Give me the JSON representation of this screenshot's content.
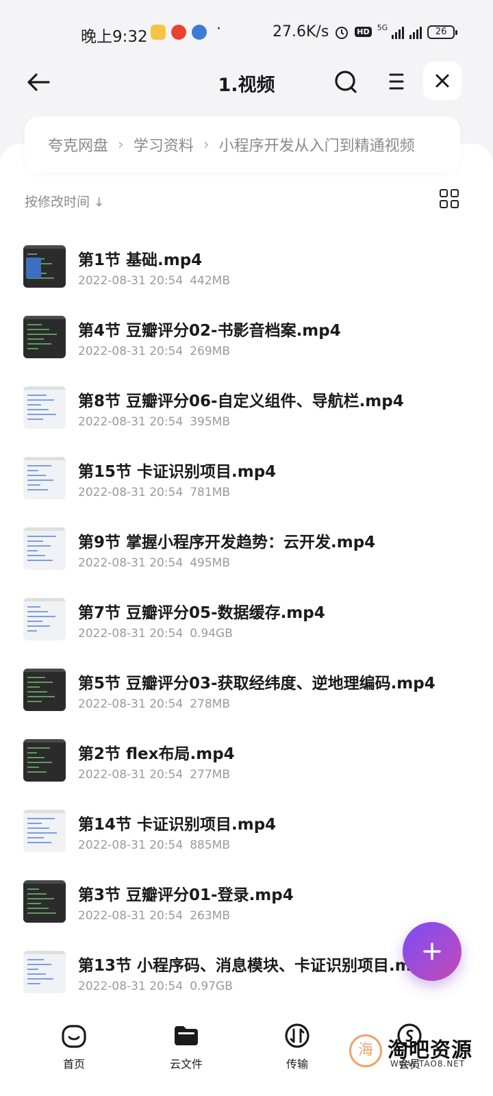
{
  "status_bar": {
    "time": "晚上9:32",
    "dot": "·",
    "speed": "27.6K/s",
    "hd": "HD",
    "network": "5G",
    "battery": "26"
  },
  "header": {
    "title": "1.视频",
    "back_icon": "arrow-left-icon",
    "search_icon": "search-icon",
    "menu_icon": "menu-icon",
    "close_icon": "close-icon"
  },
  "breadcrumb": [
    "夸克网盘",
    "学习资料",
    "小程序开发从入门到精通视频"
  ],
  "sort": {
    "label": "按修改时间",
    "arrow": "↓"
  },
  "files": [
    {
      "name": "第1节 基础.mp4",
      "date": "2022-08-31 20:54",
      "size": "442MB",
      "thumb": "dark-blue"
    },
    {
      "name": "第4节 豆瓣评分02-书影音档案.mp4",
      "date": "2022-08-31 20:54",
      "size": "269MB",
      "thumb": "dark"
    },
    {
      "name": "第8节 豆瓣评分06-自定义组件、导航栏.mp4",
      "date": "2022-08-31 20:54",
      "size": "395MB",
      "thumb": "light"
    },
    {
      "name": "第15节  卡证识别项目.mp4",
      "date": "2022-08-31 20:54",
      "size": "781MB",
      "thumb": "light"
    },
    {
      "name": "第9节 掌握小程序开发趋势：云开发.mp4",
      "date": "2022-08-31 20:54",
      "size": "495MB",
      "thumb": "light"
    },
    {
      "name": "第7节 豆瓣评分05-数据缓存.mp4",
      "date": "2022-08-31 20:54",
      "size": "0.94GB",
      "thumb": "light"
    },
    {
      "name": "第5节 豆瓣评分03-获取经纬度、逆地理编码.mp4",
      "date": "2022-08-31 20:54",
      "size": "278MB",
      "thumb": "dark"
    },
    {
      "name": "第2节 flex布局.mp4",
      "date": "2022-08-31 20:54",
      "size": "277MB",
      "thumb": "dark"
    },
    {
      "name": "第14节 卡证识别项目.mp4",
      "date": "2022-08-31 20:54",
      "size": "885MB",
      "thumb": "light"
    },
    {
      "name": "第3节 豆瓣评分01-登录.mp4",
      "date": "2022-08-31 20:54",
      "size": "263MB",
      "thumb": "dark"
    },
    {
      "name": "第13节 小程序码、消息模块、卡证识别项目.mp4",
      "date": "2022-08-31 20:54",
      "size": "0.97GB",
      "thumb": "light"
    }
  ],
  "fab": {
    "icon": "plus-icon",
    "label": "+"
  },
  "bottom_nav": [
    {
      "label": "首页",
      "icon": "home-icon"
    },
    {
      "label": "云文件",
      "icon": "folder-icon"
    },
    {
      "label": "传输",
      "icon": "transfer-icon"
    },
    {
      "label": "会员",
      "icon": "member-icon"
    }
  ],
  "watermark": {
    "char": "海",
    "text": "淘吧资源",
    "url": "WWW.TAO8.NET"
  },
  "colors": {
    "accent_start": "#7b4cf6",
    "accent_end": "#c44bb6",
    "meta_gray": "#9a9a9a"
  }
}
